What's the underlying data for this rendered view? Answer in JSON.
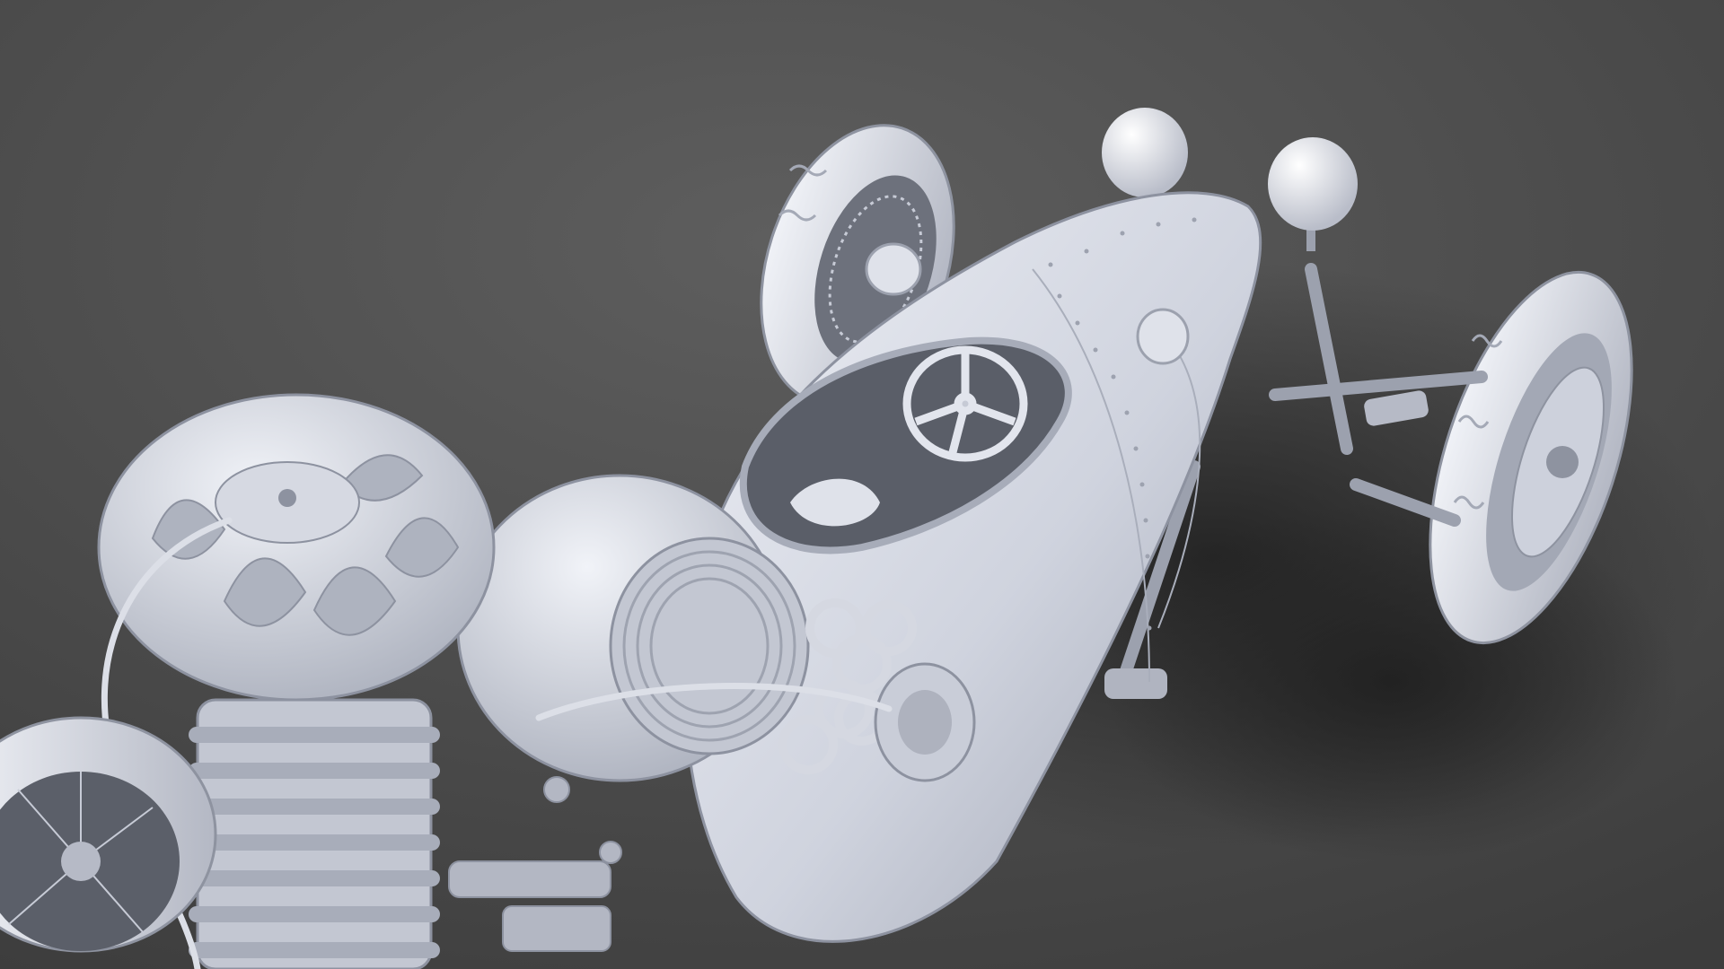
{
  "scene": {
    "subject": "vintage-race-car-clay-render",
    "colors": {
      "background_top": "#585858",
      "background_bottom": "#3f3f3f",
      "clay_light": "#e7e9f1",
      "clay_mid": "#c4c8d4",
      "clay_dark": "#8d92a0",
      "shadow": "#2c2c2c"
    }
  }
}
